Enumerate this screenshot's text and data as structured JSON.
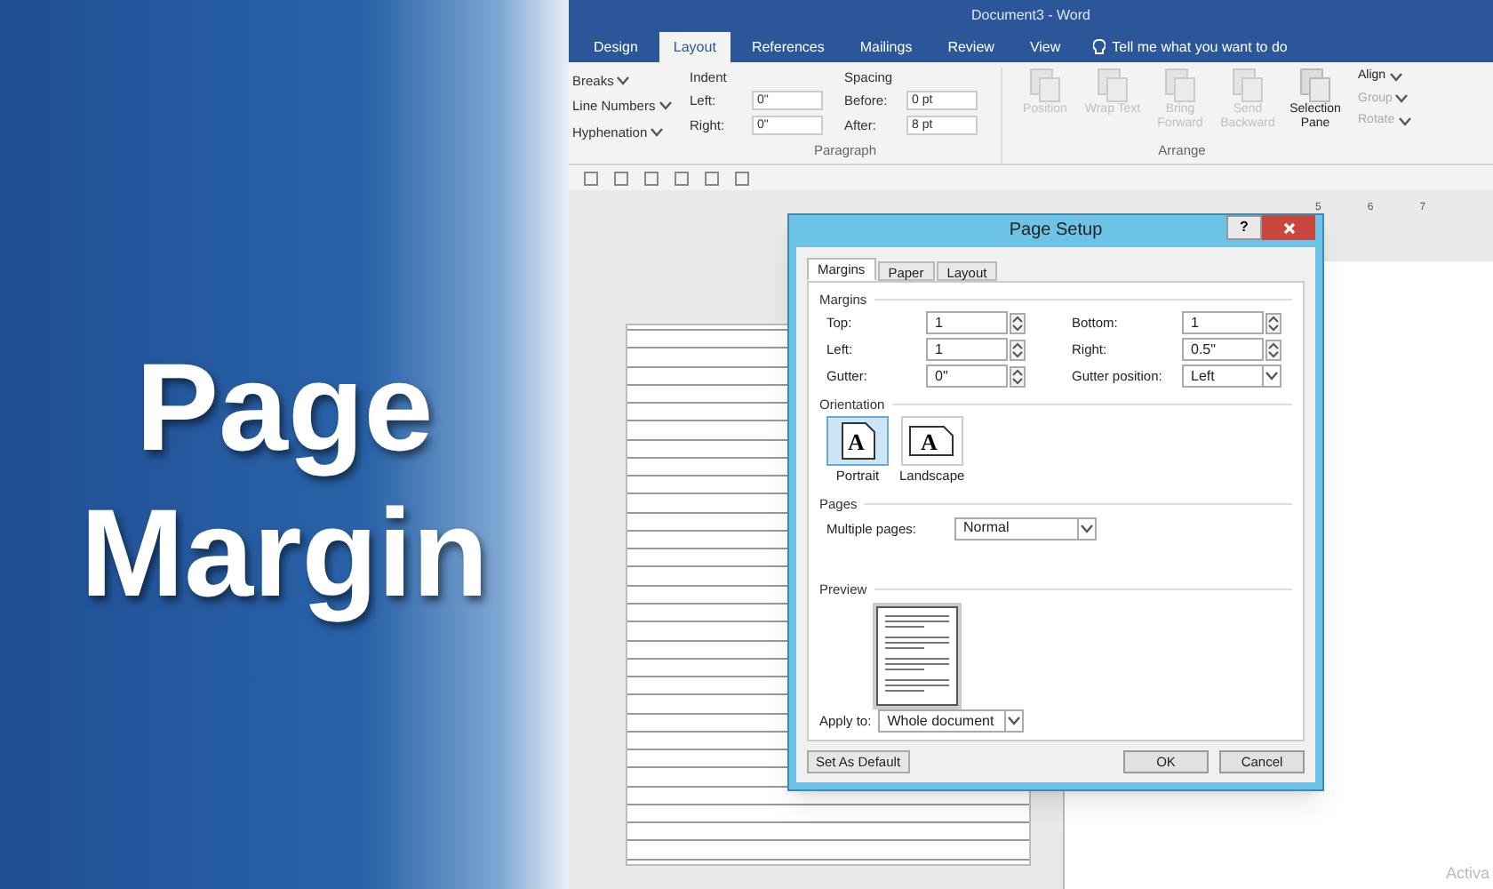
{
  "banner": {
    "title_lines": [
      "Page",
      "Margin"
    ]
  },
  "window": {
    "title": "Document3 - Word"
  },
  "tabs": [
    {
      "label": "Design",
      "selected": false
    },
    {
      "label": "Layout",
      "selected": true
    },
    {
      "label": "References",
      "selected": false
    },
    {
      "label": "Mailings",
      "selected": false
    },
    {
      "label": "Review",
      "selected": false
    },
    {
      "label": "View",
      "selected": false
    }
  ],
  "tell_me": "Tell me what you want to do",
  "ribbon": {
    "page_setup_items": [
      "Breaks",
      "Line Numbers",
      "Hyphenation"
    ],
    "indent": {
      "title": "Indent",
      "fields": [
        {
          "label": "Left:",
          "value": "0\""
        },
        {
          "label": "Right:",
          "value": "0\""
        }
      ]
    },
    "spacing": {
      "title": "Spacing",
      "fields": [
        {
          "label": "Before:",
          "value": "0 pt"
        },
        {
          "label": "After:",
          "value": "8 pt"
        }
      ]
    },
    "paragraph_label": "Paragraph",
    "arrange_buttons": [
      {
        "label": "Position",
        "disabled": true
      },
      {
        "label": "Wrap Text",
        "disabled": true
      },
      {
        "label": "Bring Forward",
        "disabled": true
      },
      {
        "label": "Send Backward",
        "disabled": true
      },
      {
        "label": "Selection Pane",
        "disabled": false
      }
    ],
    "arrange_small": [
      {
        "label": "Align",
        "disabled": false
      },
      {
        "label": "Group",
        "disabled": true
      },
      {
        "label": "Rotate",
        "disabled": true
      }
    ],
    "arrange_label": "Arrange"
  },
  "ruler": [
    "5",
    "6",
    "7"
  ],
  "dialog": {
    "title": "Page Setup",
    "help": "?",
    "tabs": [
      {
        "label": "Margins",
        "selected": true
      },
      {
        "label": "Paper",
        "selected": false
      },
      {
        "label": "Layout",
        "selected": false
      }
    ],
    "margins_title": "Margins",
    "margin_fields": [
      {
        "label": "Top:",
        "value": "1",
        "kind": "spin"
      },
      {
        "label": "Bottom:",
        "value": "1",
        "kind": "spin"
      },
      {
        "label": "Left:",
        "value": "1",
        "kind": "spin"
      },
      {
        "label": "Right:",
        "value": "0.5\"",
        "kind": "spin"
      },
      {
        "label": "Gutter:",
        "value": "0\"",
        "kind": "spin"
      },
      {
        "label": "Gutter position:",
        "value": "Left",
        "kind": "select"
      }
    ],
    "orientation_title": "Orientation",
    "orientations": [
      {
        "label": "Portrait",
        "selected": true,
        "icon_letter": "A"
      },
      {
        "label": "Landscape",
        "selected": false,
        "icon_letter": "A"
      }
    ],
    "pages_title": "Pages",
    "multiple_pages_label": "Multiple pages:",
    "multiple_pages_value": "Normal",
    "preview_title": "Preview",
    "apply_label": "Apply to:",
    "apply_value": "Whole document",
    "buttons": [
      "Set As Default",
      "OK",
      "Cancel"
    ]
  },
  "status_text": "Activa"
}
